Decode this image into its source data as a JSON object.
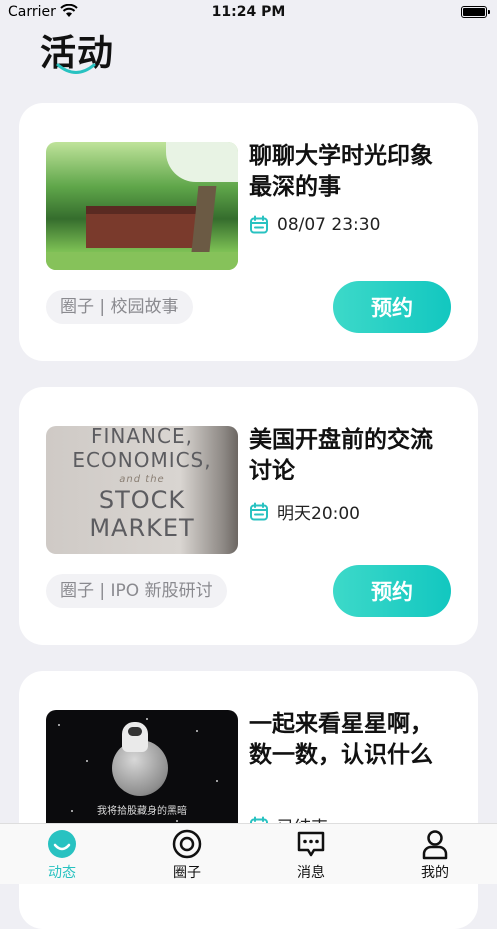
{
  "status_bar": {
    "carrier": "Carrier",
    "time": "11:24 PM"
  },
  "header": {
    "title": "活动"
  },
  "colors": {
    "accent": "#28c2c1",
    "button_gradient_start": "#3dd9c9",
    "button_gradient_end": "#12c7c0"
  },
  "activities": [
    {
      "title": "聊聊大学时光印象最深的事",
      "time": "08/07 23:30",
      "tag": "圈子 | 校园故事",
      "action": "预约"
    },
    {
      "title": "美国开盘前的交流讨论",
      "time": "明天20:00",
      "tag": "圈子 | IPO 新股研讨",
      "action": "预约",
      "image_text": [
        "FINANCE,",
        "ECONOMICS,",
        "and the",
        "STOCK",
        "MARKET"
      ]
    },
    {
      "title": "一起来看星星啊，数一数，认识什么",
      "time": "已结束",
      "image_caption": "我将拾股藏身的黑暗"
    }
  ],
  "tabbar": {
    "tabs": [
      {
        "label": "动态",
        "icon": "smile-icon",
        "active": true
      },
      {
        "label": "圈子",
        "icon": "circle-icon",
        "active": false
      },
      {
        "label": "消息",
        "icon": "message-icon",
        "active": false
      },
      {
        "label": "我的",
        "icon": "person-icon",
        "active": false
      }
    ]
  }
}
